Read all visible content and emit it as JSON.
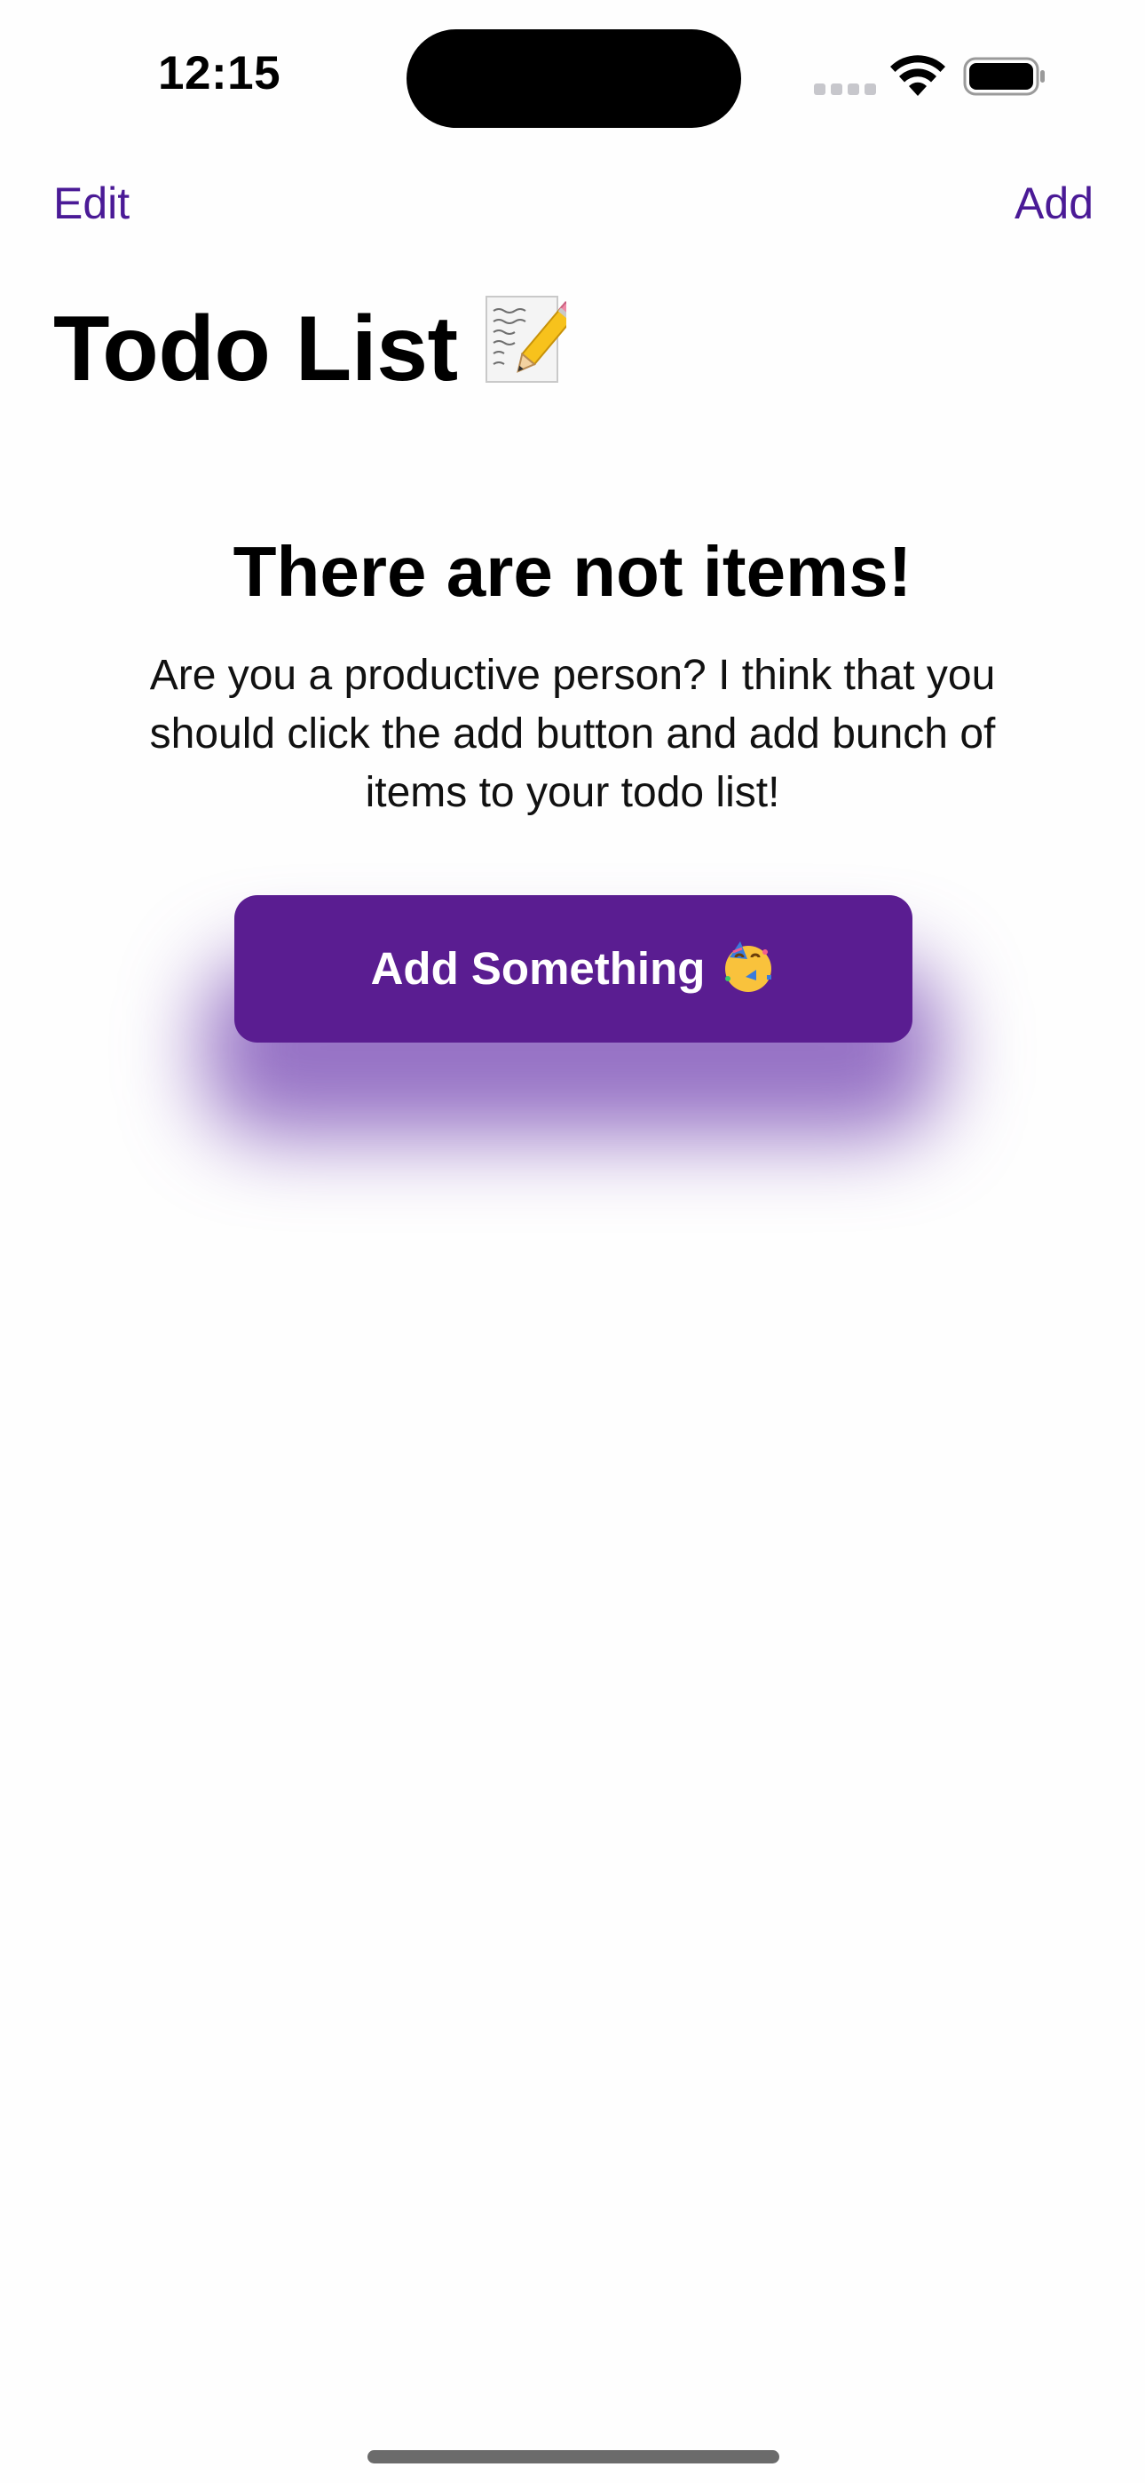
{
  "status_bar": {
    "time": "12:15"
  },
  "nav": {
    "edit_label": "Edit",
    "add_label": "Add"
  },
  "title": {
    "text": "Todo List",
    "emoji_icon": "memo-icon"
  },
  "empty_state": {
    "heading": "There are not items!",
    "body": "Are you a productive person? I think that you should click the add button and add bunch of items to your todo list!"
  },
  "cta": {
    "label": "Add Something",
    "emoji_icon": "partying-face-icon"
  },
  "colors": {
    "accent": "#4a1a96",
    "button": "#5a1d91",
    "background": "#fefefe"
  }
}
